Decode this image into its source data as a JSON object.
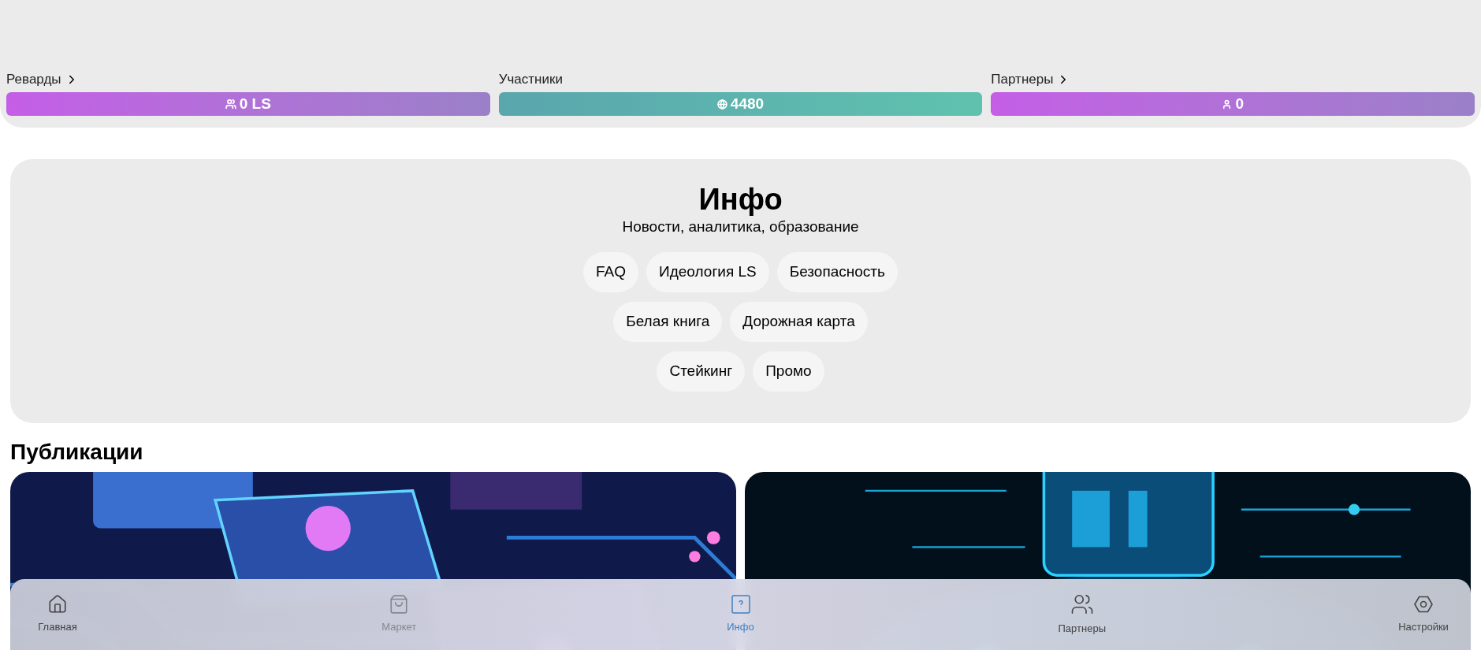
{
  "stats": [
    {
      "label": "Реварды",
      "has_chevron": true,
      "value": "0 LS"
    },
    {
      "label": "Участники",
      "has_chevron": false,
      "value": "4480"
    },
    {
      "label": "Партнеры",
      "has_chevron": true,
      "value": "0"
    }
  ],
  "info": {
    "title": "Инфо",
    "subtitle": "Новости, аналитика, образование",
    "chip_rows": [
      [
        "FAQ",
        "Идеология LS",
        "Безопасность"
      ],
      [
        "Белая книга",
        "Дорожная карта"
      ],
      [
        "Стейкинг",
        "Промо"
      ]
    ]
  },
  "publications": {
    "title": "Публикации"
  },
  "nav": [
    {
      "label": "Главная",
      "selected": false,
      "disabled": false
    },
    {
      "label": "Маркет",
      "selected": false,
      "disabled": true
    },
    {
      "label": "Инфо",
      "selected": true,
      "disabled": false
    },
    {
      "label": "Партнеры",
      "selected": false,
      "disabled": false
    },
    {
      "label": "Настройки",
      "selected": false,
      "disabled": false
    }
  ]
}
